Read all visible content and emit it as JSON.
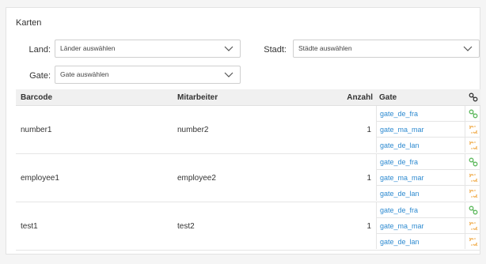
{
  "page": {
    "title": "Karten"
  },
  "filters": {
    "land": {
      "label": "Land:",
      "placeholder": "Länder auswählen"
    },
    "stadt": {
      "label": "Stadt:",
      "placeholder": "Städte auswählen"
    },
    "gate": {
      "label": "Gate:",
      "placeholder": "Gate auswählen"
    }
  },
  "table": {
    "headers": {
      "barcode": "Barcode",
      "mitarbeiter": "Mitarbeiter",
      "anzahl": "Anzahl",
      "gate": "Gate",
      "link_icon": "link-icon"
    },
    "rows": [
      {
        "barcode": "number1",
        "mitarbeiter": "number2",
        "anzahl": "1",
        "gates": [
          {
            "name": "gate_de_fra",
            "status": "linked"
          },
          {
            "name": "gate_ma_mar",
            "status": "unlinked"
          },
          {
            "name": "gate_de_lan",
            "status": "unlinked"
          }
        ]
      },
      {
        "barcode": "employee1",
        "mitarbeiter": "employee2",
        "anzahl": "1",
        "gates": [
          {
            "name": "gate_de_fra",
            "status": "linked"
          },
          {
            "name": "gate_ma_mar",
            "status": "unlinked"
          },
          {
            "name": "gate_de_lan",
            "status": "unlinked"
          }
        ]
      },
      {
        "barcode": "test1",
        "mitarbeiter": "test2",
        "anzahl": "1",
        "gates": [
          {
            "name": "gate_de_fra",
            "status": "linked"
          },
          {
            "name": "gate_ma_mar",
            "status": "unlinked"
          },
          {
            "name": "gate_de_lan",
            "status": "unlinked"
          }
        ]
      }
    ]
  },
  "colors": {
    "link": "#2d8ad0",
    "linked_icon": "#5cb85c",
    "unlinked_icon": "#f0ad4e"
  }
}
